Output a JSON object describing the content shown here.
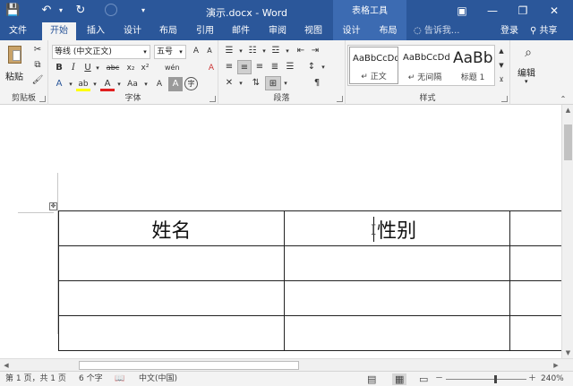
{
  "window": {
    "title": "演示.docx - Word",
    "context_group": "表格工具",
    "controls": {
      "ribbon_display": "▣",
      "minimize": "—",
      "restore": "❐",
      "close": "✕"
    }
  },
  "qat": {
    "save": "💾",
    "undo": "↶",
    "undo_more": "▾",
    "redo": "↻",
    "customize": "▾"
  },
  "tabs": [
    "文件",
    "开始",
    "插入",
    "设计",
    "布局",
    "引用",
    "邮件",
    "审阅",
    "视图",
    "设计",
    "布局"
  ],
  "active_tab": "开始",
  "tell_me": "告诉我...",
  "signin": "登录",
  "share": "共享",
  "ribbon": {
    "clipboard": {
      "label": "剪贴板",
      "paste": "粘贴"
    },
    "font": {
      "label": "字体",
      "name": "等线 (中文正文)",
      "size": "五号",
      "grow": "A",
      "shrink": "A",
      "aa": "Aa",
      "wen": "wén",
      "clear": "A",
      "bold": "B",
      "italic": "I",
      "underline": "U",
      "strike": "abc",
      "sub": "x₂",
      "sup": "x²",
      "effects": "A",
      "highlight": "ab",
      "color": "A",
      "charshade": "A",
      "aa2": "Aa",
      "enclose": "字"
    },
    "paragraph": {
      "label": "段落"
    },
    "styles": {
      "label": "样式",
      "items": [
        {
          "sample": "AaBbCcDd",
          "name": "↵ 正文"
        },
        {
          "sample": "AaBbCcDd",
          "name": "↵ 无间隔"
        },
        {
          "sample": "AaBb",
          "name": "标题 1"
        }
      ]
    },
    "editing": {
      "label": "编辑"
    }
  },
  "document": {
    "table": [
      [
        "姓名",
        "性别",
        ""
      ],
      [
        "",
        "",
        ""
      ],
      [
        "",
        "",
        ""
      ],
      [
        "",
        "",
        ""
      ]
    ]
  },
  "status": {
    "page": "第 1 页，共 1 页",
    "words": "6 个字",
    "language": "中文(中国)",
    "zoom": "240%",
    "zoom_out": "－",
    "zoom_in": "＋"
  }
}
